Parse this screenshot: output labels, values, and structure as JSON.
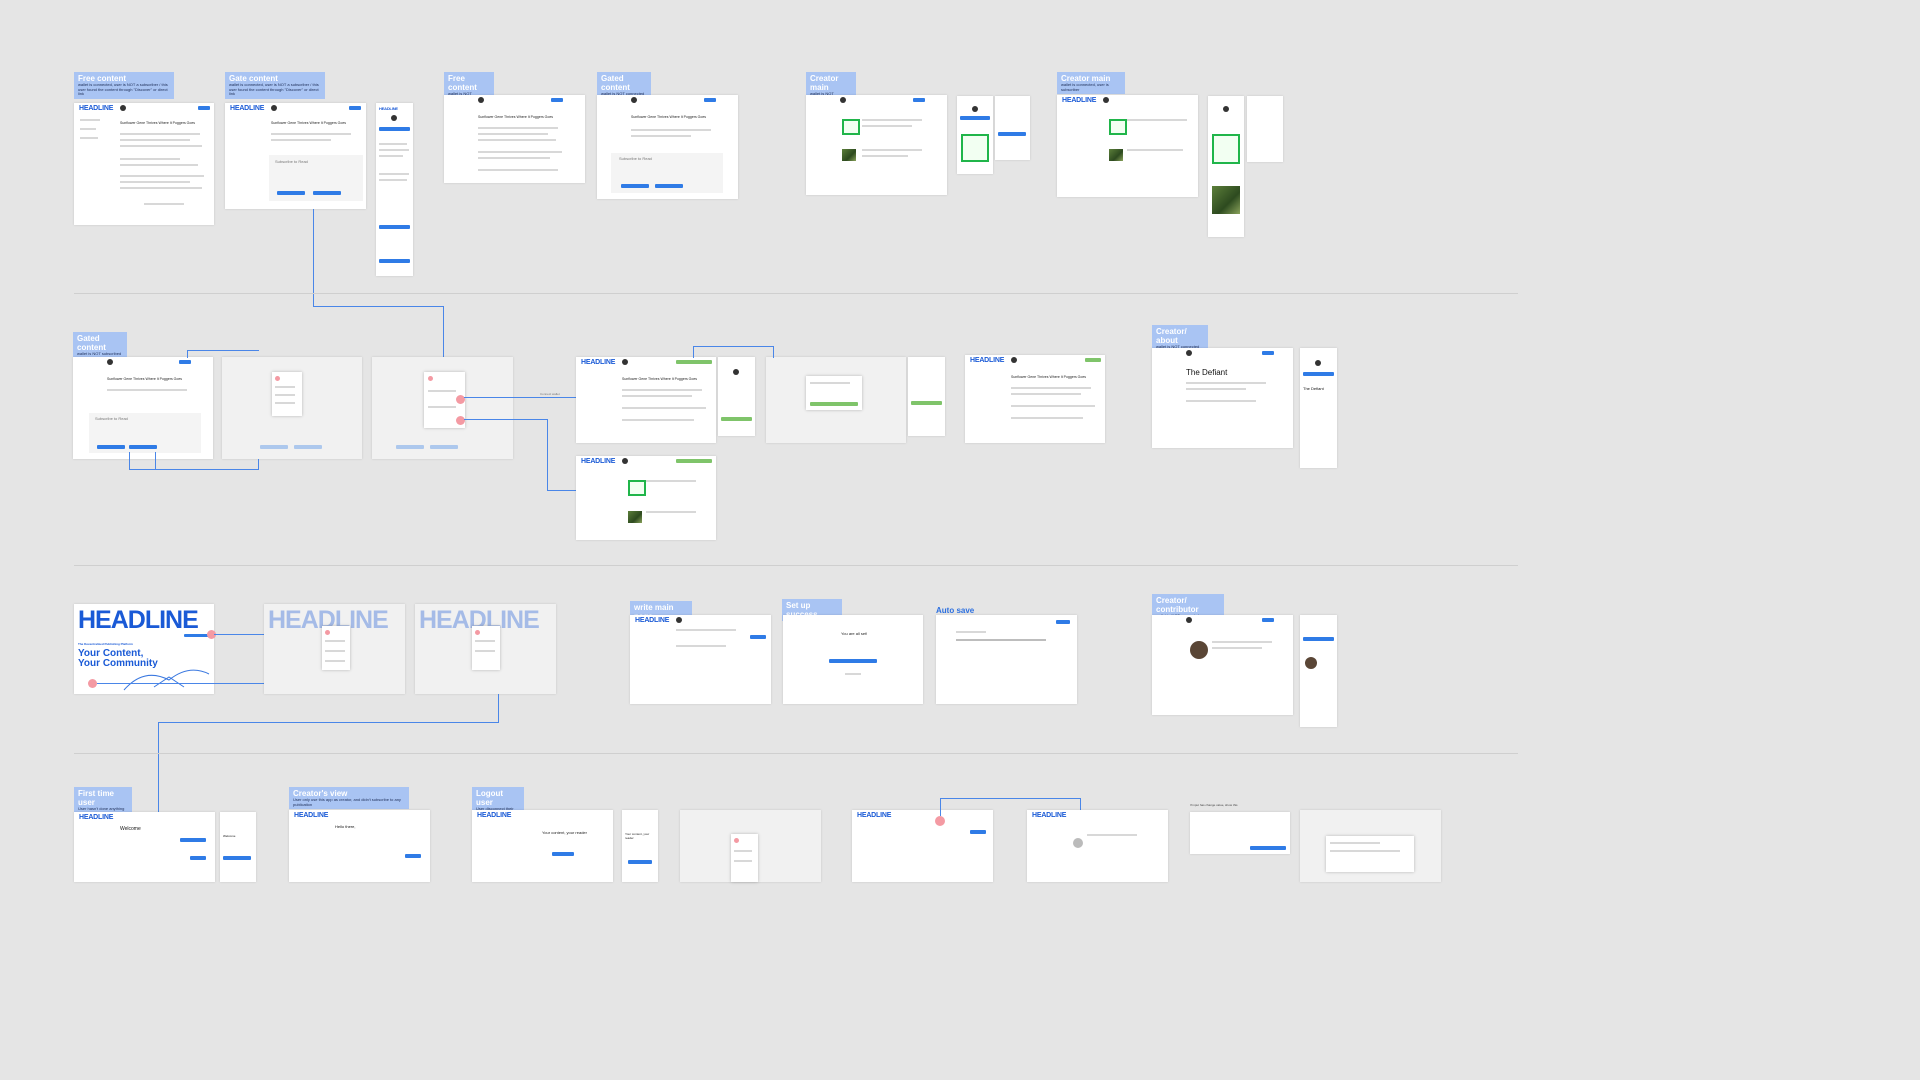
{
  "labels": {
    "free_content_1": {
      "title": "Free content",
      "sub": "wallet is connected, user is NOT a subscriber / this user found the content through \"Discover\" or direct link"
    },
    "gate_content": {
      "title": "Gate content",
      "sub": "wallet is connected, user is NOT a subscriber / this user found the content through \"Discover\" or direct link"
    },
    "free_content_2": {
      "title": "Free content",
      "sub": "wallet is NOT connected"
    },
    "gated_content_top": {
      "title": "Gated content",
      "sub": "wallet is NOT connected"
    },
    "creator_main_1": {
      "title": "Creator main",
      "sub": "wallet is NOT connected"
    },
    "creator_main_2": {
      "title": "Creator main",
      "sub": "wallet is connected, user is subscriber"
    },
    "gated_content_mid": {
      "title": "Gated content",
      "sub": "wallet is NOT subscribed"
    },
    "creator_about": {
      "title": "Creator/ about",
      "sub": "wallet is NOT connected"
    },
    "write_main_page": {
      "title": "write main page",
      "sub": ""
    },
    "set_up_success": {
      "title": "Set up success",
      "sub": ""
    },
    "creator_contributor": {
      "title": "Creator/ contributor",
      "sub": "wallet is NOT connected"
    },
    "first_time_user": {
      "title": "First time user",
      "sub": "User hasn't done anything yet"
    },
    "creators_view": {
      "title": "Creator's view",
      "sub": "User only use this app as creator, and didn't subscribe to any publication"
    },
    "logout_user": {
      "title": "Logout user",
      "sub": "User disconnect their wallet"
    }
  },
  "auto_save": "Auto save",
  "brand": "HEADLINE",
  "article_title": "Sunflower Gene Thrives Where It Poggers Goes",
  "subscribe_heading": "Subscribe to Read",
  "the_defiant": "The Defiant",
  "hero": {
    "title": "HEADLINE",
    "tagline": "The Decentralized Publishing Platform",
    "line1": "Your Content,",
    "line2": "Your Community"
  },
  "welcome": "Welcome",
  "your_content": "Your content, your reader",
  "hello": "Hello there,",
  "set_up_msg": "You are all set!",
  "notes": {
    "connector_note": "Connect wallet",
    "branch_note": "If input has change value, show this"
  }
}
